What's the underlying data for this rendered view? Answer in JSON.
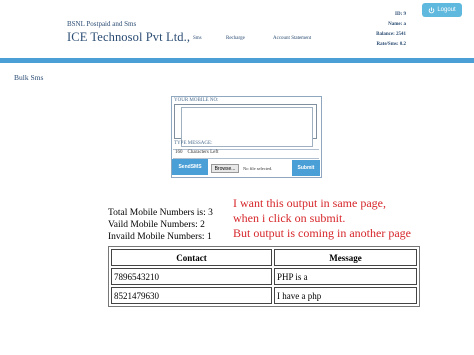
{
  "header": {
    "subtitle": "BSNL Postpaid and Sms",
    "title": "ICE Technosol Pvt Ltd.,",
    "nav": [
      "Sms",
      "Recharge",
      "Account Statement"
    ],
    "logout_label": "Logout",
    "info": {
      "id_label": "ID:",
      "id_value": "9",
      "name_label": "Name:",
      "name_value": "a",
      "balance_label": "Balance:",
      "balance_value": "2541",
      "rate_label": "Rate/Sms:",
      "rate_value": "0.2"
    }
  },
  "page_heading": "Bulk Sms",
  "form": {
    "mobile_label": "YOUR MOBILE NO:",
    "message_label": "TYPE MESSAGE:",
    "chars_count": "160",
    "chars_label": "Characters Left",
    "send_button": "SendSMS",
    "browse_button": "Browse...",
    "no_file_text": "No file selected.",
    "submit_button": "Submit"
  },
  "annotation": {
    "line1": "I want this output in same page,",
    "line2": "when i click on submit.",
    "line3": "But output is coming in another page"
  },
  "results": {
    "total": "Total Mobile Numbers is: 3",
    "valid": "Vaild Mobile Numbers: 2",
    "invalid": "Invaild Mobile Numbers: 1",
    "columns": [
      "Contact",
      "Message"
    ],
    "rows": [
      {
        "contact": "7896543210",
        "message": "PHP is a"
      },
      {
        "contact": "8521479630",
        "message": "I have a php"
      }
    ]
  },
  "colors": {
    "accent": "#4a9fd6",
    "annotation": "#d6262a",
    "header_text": "#2b4c73"
  }
}
